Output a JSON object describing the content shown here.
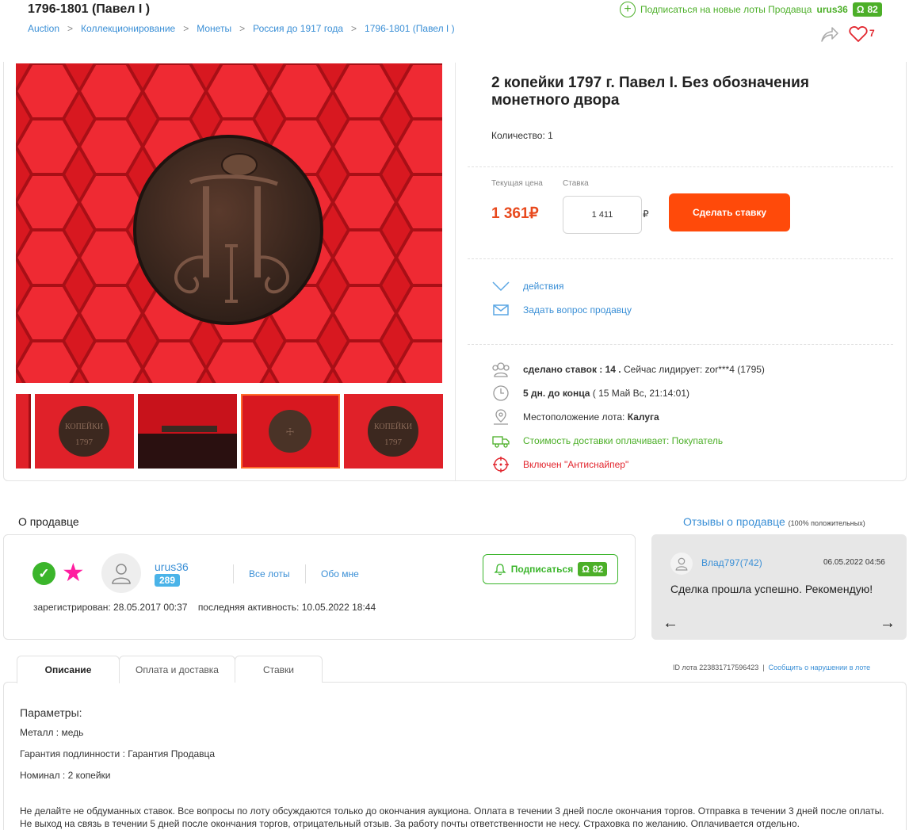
{
  "header": {
    "title": "1796-1801 (Павел I )",
    "breadcrumbs": [
      "Auction",
      "Коллекционирование",
      "Монеты",
      "Россия до 1917 года",
      "1796-1801 (Павел I )"
    ],
    "subscribe_text": "Подписаться на новые лоты Продавца",
    "seller_name": "urus36",
    "subscribers": "82",
    "favorites_count": "7"
  },
  "lot": {
    "title": "2 копейки 1797 г. Павел I. Без обозначения монетного двора",
    "quantity": "Количество: 1",
    "current_price_label": "Текущая цена",
    "current_price": "1 361₽",
    "bid_label": "Ставка",
    "bid_value": "1 411",
    "currency": "₽",
    "bid_button": "Сделать ставку",
    "actions_link": "действия",
    "ask_link": "Задать вопрос продавцу",
    "bids_prefix": "сделано ставок : 14 .",
    "bids_leader": "Сейчас лидирует: zor***4 (1795)",
    "time_left": "5 дн. до конца",
    "end_date": "( 15 Май Вс, 21:14:01)",
    "location_label": "Местоположение лота:",
    "location": "Калуга",
    "delivery": "Стоимость доставки оплачивает: Покупатель",
    "antisniper": "Включен \"Антиснайпер\"",
    "thumb_count": 5,
    "active_thumb": 4
  },
  "seller": {
    "heading": "О продавце",
    "name": "urus36",
    "rating": "289",
    "all_lots": "Все лоты",
    "about": "Обо мне",
    "registered": "зарегистрирован: 28.05.2017 00:37",
    "last_active": "последняя активность: 10.05.2022 18:44",
    "subscribe_button": "Подписаться",
    "subscribers": "82"
  },
  "reviews": {
    "heading": "Отзывы о продавце",
    "heading_note": "(100% положительных)",
    "author": "Влад797(742)",
    "date": "06.05.2022 04:56",
    "text": "Сделка прошла успешно. Рекомендую!"
  },
  "tabs": {
    "items": [
      "Описание",
      "Оплата и доставка",
      "Ставки"
    ],
    "active": 0,
    "lot_id": "ID лота 223831717596423",
    "separator": "|",
    "report": "Сообщить о нарушении в лоте"
  },
  "description": {
    "params_title": "Параметры:",
    "metal": "Металл : медь",
    "guarantee": "Гарантия подлинности : Гарантия Продавца",
    "nominal": "Номинал : 2 копейки",
    "note_line1": "Не делайте не обдуманных ставок. Все вопросы по лоту обсуждаются только до окончания аукциона. Оплата в течении 3 дней после окончания торгов. Отправка в течении 3 дней после оплаты.",
    "note_line2": "Не выход на связь в течении 5 дней после окончания торгов, отрицательный отзыв. За работу почты ответственности не несу. Страховка по желанию. Оплачивается отдельно."
  },
  "colors": {
    "accent": "#ff4a0a",
    "link": "#3a8fd6",
    "green": "#4caf28",
    "price": "#e8491d"
  }
}
